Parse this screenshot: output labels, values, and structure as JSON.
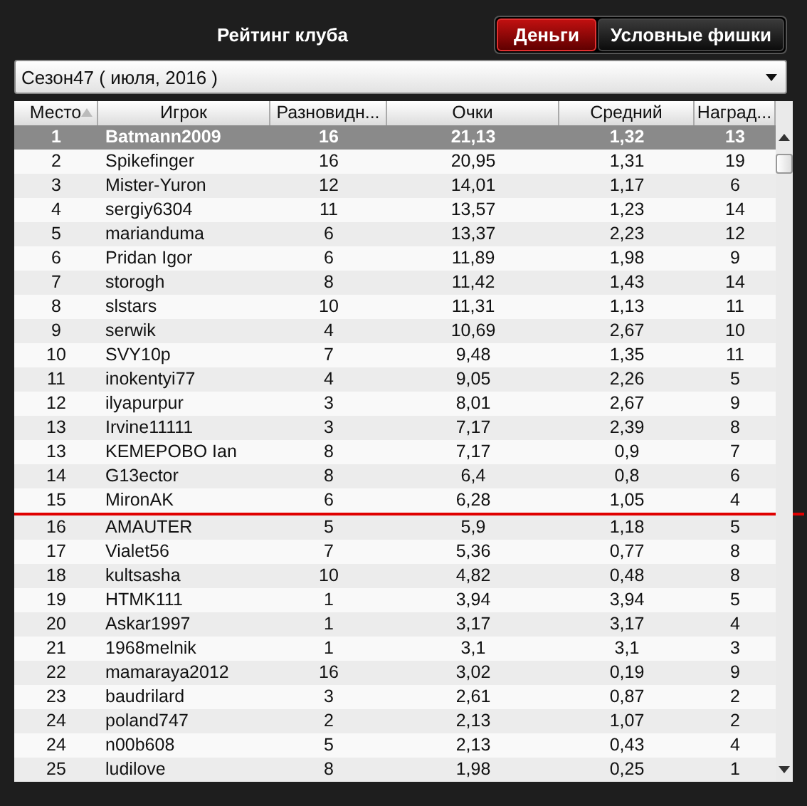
{
  "title": "Рейтинг клуба",
  "tabs": [
    {
      "label": "Деньги",
      "selected": true
    },
    {
      "label": "Условные фишки",
      "selected": false
    }
  ],
  "season": {
    "value": "Сезон47 ( июля, 2016 )"
  },
  "table": {
    "columns": [
      {
        "label": "Место",
        "sorted": true
      },
      {
        "label": "Игрок",
        "sorted": false
      },
      {
        "label": "Разновидн...",
        "sorted": false
      },
      {
        "label": "Очки",
        "sorted": false
      },
      {
        "label": "Средний",
        "sorted": false
      },
      {
        "label": "Наград...",
        "sorted": false
      }
    ],
    "rows": [
      {
        "cells": [
          "1",
          "Batmann2009",
          "16",
          "21,13",
          "1,32",
          "13"
        ],
        "selected": true,
        "marked_below": false
      },
      {
        "cells": [
          "2",
          "Spikefinger",
          "16",
          "20,95",
          "1,31",
          "19"
        ],
        "selected": false,
        "marked_below": false
      },
      {
        "cells": [
          "3",
          "Mister-Yuron",
          "12",
          "14,01",
          "1,17",
          "6"
        ],
        "selected": false,
        "marked_below": false
      },
      {
        "cells": [
          "4",
          "sergiy6304",
          "11",
          "13,57",
          "1,23",
          "14"
        ],
        "selected": false,
        "marked_below": false
      },
      {
        "cells": [
          "5",
          "marianduma",
          "6",
          "13,37",
          "2,23",
          "12"
        ],
        "selected": false,
        "marked_below": false
      },
      {
        "cells": [
          "6",
          "Pridan Igor",
          "6",
          "11,89",
          "1,98",
          "9"
        ],
        "selected": false,
        "marked_below": false
      },
      {
        "cells": [
          "7",
          "storogh",
          "8",
          "11,42",
          "1,43",
          "14"
        ],
        "selected": false,
        "marked_below": false
      },
      {
        "cells": [
          "8",
          "slstars",
          "10",
          "11,31",
          "1,13",
          "11"
        ],
        "selected": false,
        "marked_below": false
      },
      {
        "cells": [
          "9",
          "serwik",
          "4",
          "10,69",
          "2,67",
          "10"
        ],
        "selected": false,
        "marked_below": false
      },
      {
        "cells": [
          "10",
          "SVY10p",
          "7",
          "9,48",
          "1,35",
          "11"
        ],
        "selected": false,
        "marked_below": false
      },
      {
        "cells": [
          "11",
          "inokentyi77",
          "4",
          "9,05",
          "2,26",
          "5"
        ],
        "selected": false,
        "marked_below": false
      },
      {
        "cells": [
          "12",
          "ilyapurpur",
          "3",
          "8,01",
          "2,67",
          "9"
        ],
        "selected": false,
        "marked_below": false
      },
      {
        "cells": [
          "13",
          "Irvine11111",
          "3",
          "7,17",
          "2,39",
          "8"
        ],
        "selected": false,
        "marked_below": false
      },
      {
        "cells": [
          "13",
          "KEMEPOBO Ian",
          "8",
          "7,17",
          "0,9",
          "7"
        ],
        "selected": false,
        "marked_below": false
      },
      {
        "cells": [
          "14",
          "G13ector",
          "8",
          "6,4",
          "0,8",
          "6"
        ],
        "selected": false,
        "marked_below": false
      },
      {
        "cells": [
          "15",
          "MironAK",
          "6",
          "6,28",
          "1,05",
          "4"
        ],
        "selected": false,
        "marked_below": true
      },
      {
        "cells": [
          "16",
          "AMAUTER",
          "5",
          "5,9",
          "1,18",
          "5"
        ],
        "selected": false,
        "marked_below": false
      },
      {
        "cells": [
          "17",
          "Vialet56",
          "7",
          "5,36",
          "0,77",
          "8"
        ],
        "selected": false,
        "marked_below": false
      },
      {
        "cells": [
          "18",
          "kultsasha",
          "10",
          "4,82",
          "0,48",
          "8"
        ],
        "selected": false,
        "marked_below": false
      },
      {
        "cells": [
          "19",
          "HTMK111",
          "1",
          "3,94",
          "3,94",
          "5"
        ],
        "selected": false,
        "marked_below": false
      },
      {
        "cells": [
          "20",
          "Askar1997",
          "1",
          "3,17",
          "3,17",
          "4"
        ],
        "selected": false,
        "marked_below": false
      },
      {
        "cells": [
          "21",
          "1968melnik",
          "1",
          "3,1",
          "3,1",
          "3"
        ],
        "selected": false,
        "marked_below": false
      },
      {
        "cells": [
          "22",
          "mamaraya2012",
          "16",
          "3,02",
          "0,19",
          "9"
        ],
        "selected": false,
        "marked_below": false
      },
      {
        "cells": [
          "23",
          "baudrilard",
          "3",
          "2,61",
          "0,87",
          "2"
        ],
        "selected": false,
        "marked_below": false
      },
      {
        "cells": [
          "24",
          "poland747",
          "2",
          "2,13",
          "1,07",
          "2"
        ],
        "selected": false,
        "marked_below": false
      },
      {
        "cells": [
          "24",
          "n00b608",
          "5",
          "2,13",
          "0,43",
          "4"
        ],
        "selected": false,
        "marked_below": false
      },
      {
        "cells": [
          "25",
          "ludilove",
          "8",
          "1,98",
          "0,25",
          "1"
        ],
        "selected": false,
        "marked_below": false
      }
    ]
  }
}
